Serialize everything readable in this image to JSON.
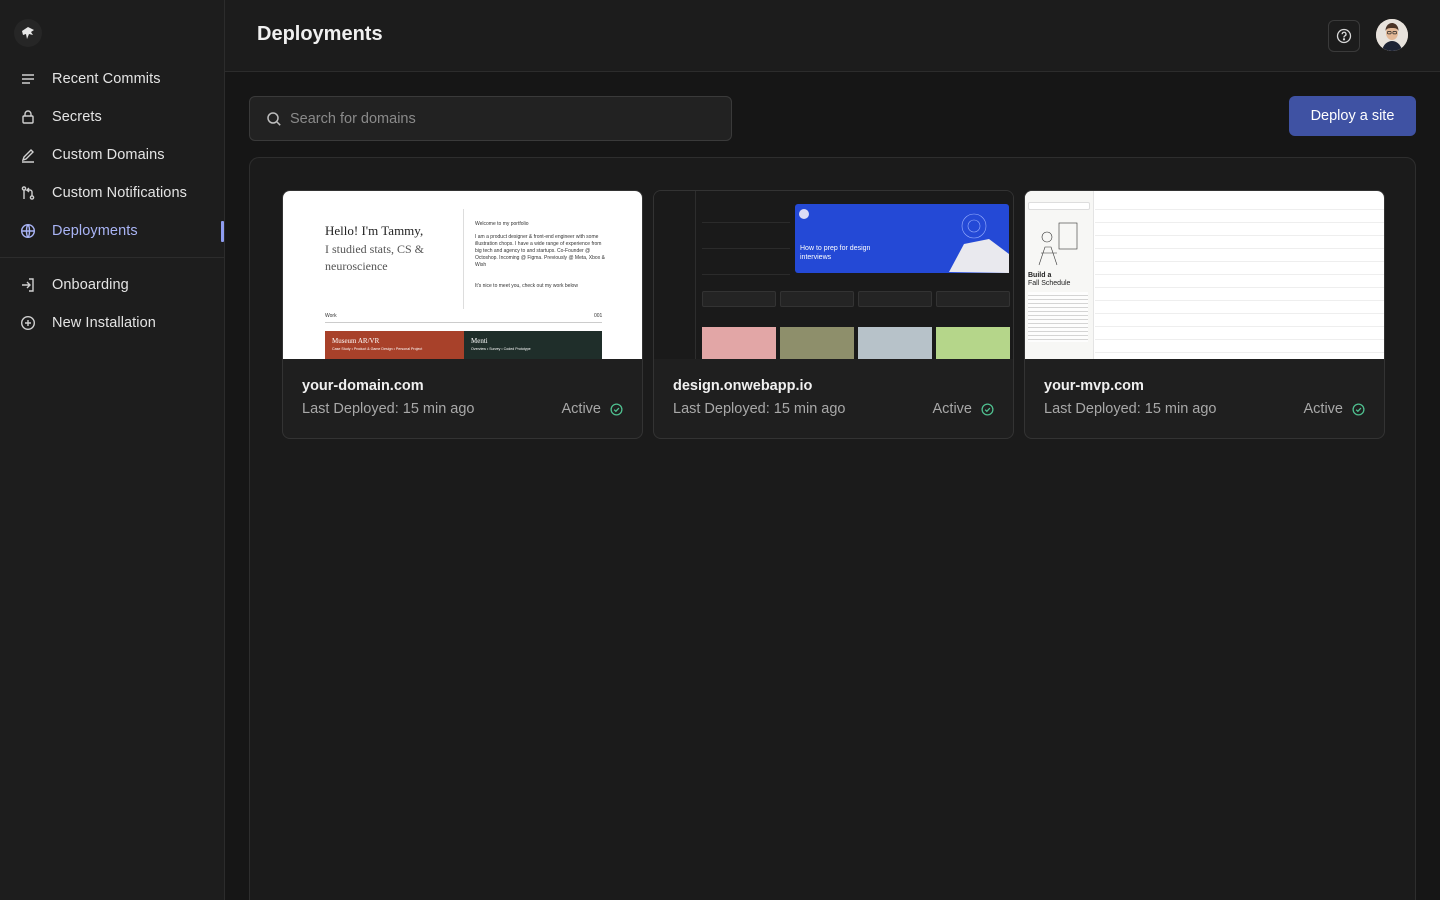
{
  "sidebar": {
    "items": [
      {
        "label": "Recent Commits",
        "icon": "list-icon"
      },
      {
        "label": "Secrets",
        "icon": "lock-icon"
      },
      {
        "label": "Custom Domains",
        "icon": "pen-icon"
      },
      {
        "label": "Custom Notifications",
        "icon": "git-pull-icon"
      },
      {
        "label": "Deployments",
        "icon": "globe-icon",
        "active": true
      },
      {
        "label": "Onboarding",
        "icon": "login-icon"
      },
      {
        "label": "New Installation",
        "icon": "plus-circle-icon"
      }
    ]
  },
  "header": {
    "title": "Deployments"
  },
  "toolbar": {
    "search_placeholder": "Search for domains",
    "deploy_label": "Deploy a site"
  },
  "colors": {
    "accent": "#3f52a3",
    "active_nav": "#a9b4f5",
    "status_ok": "#4fbf8f"
  },
  "deployments": [
    {
      "domain": "your-domain.com",
      "last_deployed": "Last Deployed: 15 min ago",
      "status": "Active"
    },
    {
      "domain": "design.onwebapp.io",
      "last_deployed": "Last Deployed: 15 min ago",
      "status": "Active"
    },
    {
      "domain": "your-mvp.com",
      "last_deployed": "Last Deployed: 15 min ago",
      "status": "Active"
    }
  ],
  "previews": {
    "portfolio": {
      "greeting": "Hello! I'm Tammy,",
      "subtitle": "I studied stats, CS & neuroscience",
      "welcome": "Welcome to my portfolio",
      "bio": "I am a product designer & front-end engineer with some illustration chops. I have a wide range of experience from big tech and agency to and startups. Co-Founder @ Octoshop. Incoming @ Figma. Previously @ Meta, Xbox & Wish",
      "cta": "It's nice to meet you, check out my work below",
      "work_label": "Work",
      "work_count": "001",
      "projects": [
        {
          "name": "Museum AR/VR",
          "tags": "Case Study • Product & Game Design • Personal Project"
        },
        {
          "name": "Menti",
          "tags": "Overview • Survey • Coded Prototype"
        }
      ]
    },
    "app": {
      "banner_text": "How to prep for design interviews"
    },
    "schedule": {
      "title_line1": "Build a",
      "title_line2": "Fall Schedule"
    }
  }
}
